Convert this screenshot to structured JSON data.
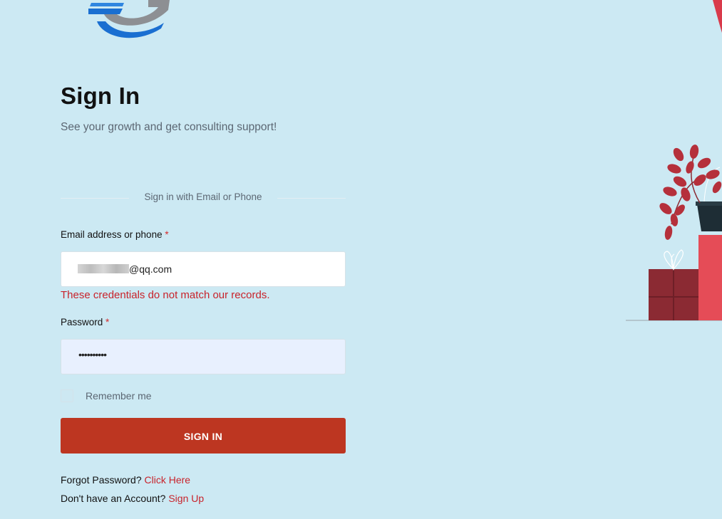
{
  "header": {
    "title": "Sign In",
    "subtitle": "See your growth and get consulting support!"
  },
  "divider_text": "Sign in with Email or Phone",
  "email_field": {
    "label": "Email address or phone",
    "required_mark": "*",
    "value": "@qq.com"
  },
  "error_message": "These credentials do not match our records.",
  "password_field": {
    "label": "Password",
    "required_mark": "*",
    "value": "••••••••••"
  },
  "remember": {
    "label": "Remember me",
    "checked": false
  },
  "signin_button": {
    "label": "SIGN IN"
  },
  "forgot": {
    "text": "Forgot Password?",
    "link": "Click Here"
  },
  "signup": {
    "text": "Don't have an Account?",
    "link": "Sign Up"
  },
  "colors": {
    "background": "#cce9f3",
    "accent": "#bd3621",
    "error": "#c8232b",
    "logo_blue": "#1a6fd1",
    "logo_gray": "#8d8f93",
    "illustration_red": "#e54c57",
    "illustration_dark_red": "#8b2a33"
  },
  "icons": [
    "company-logo-icon",
    "plant-gift-illustration",
    "corner-decoration-shape"
  ]
}
